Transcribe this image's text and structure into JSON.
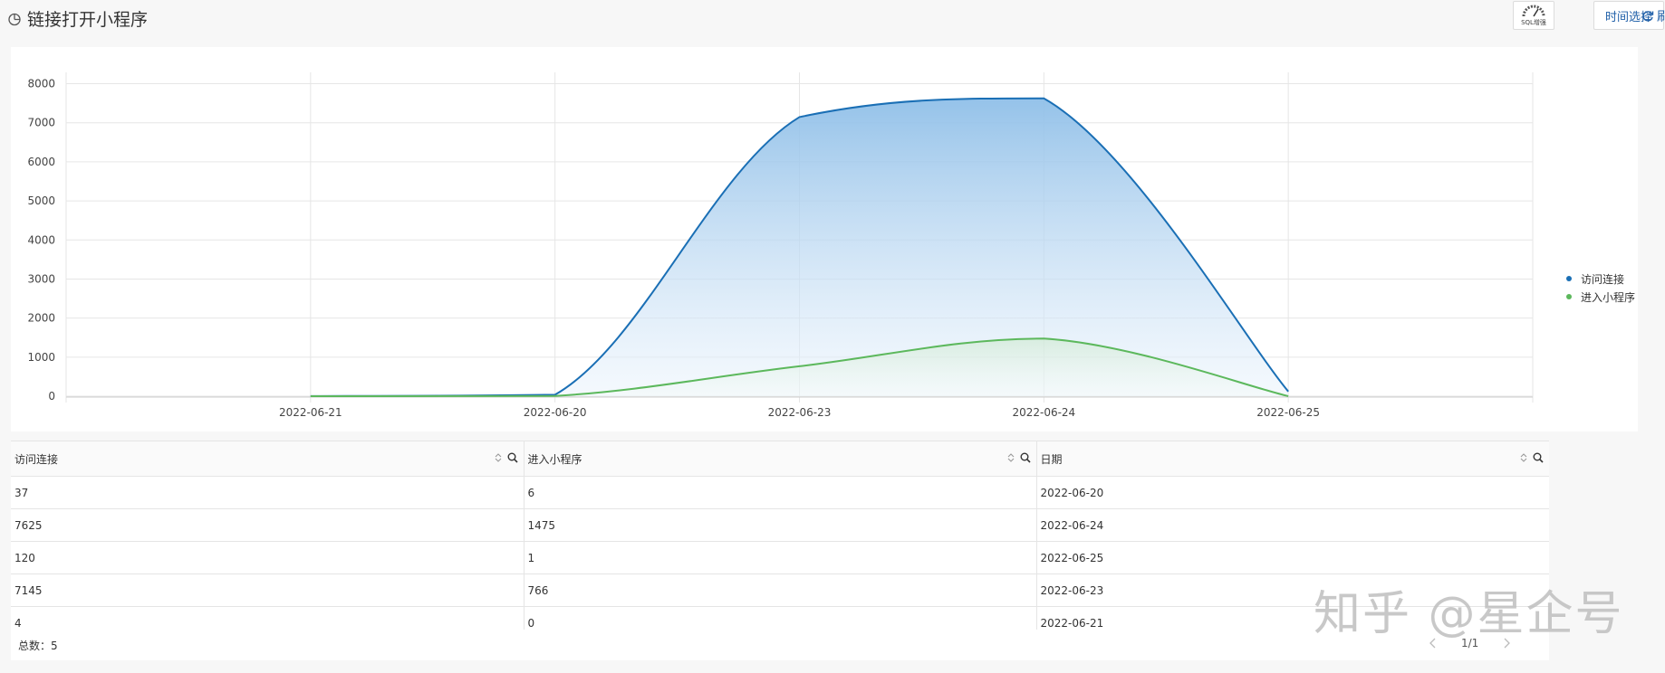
{
  "header": {
    "title": "链接打开小程序",
    "sql_label": "SQL增强",
    "time_button": "时间选择",
    "refresh_label": "刷"
  },
  "chart_data": {
    "type": "area",
    "x": [
      "2022-06-21",
      "2022-06-20",
      "2022-06-23",
      "2022-06-24",
      "2022-06-25"
    ],
    "series": [
      {
        "name": "访问连接",
        "values": [
          4,
          37,
          7145,
          7625,
          120
        ],
        "color": "#1a6fb5"
      },
      {
        "name": "进入小程序",
        "values": [
          0,
          6,
          766,
          1475,
          1
        ],
        "color": "#5cb85c"
      }
    ],
    "ylim": [
      0,
      8000
    ],
    "yticks": [
      0,
      1000,
      2000,
      3000,
      4000,
      5000,
      6000,
      7000,
      8000
    ],
    "grid": true,
    "legend_position": "right"
  },
  "table": {
    "columns": [
      "访问连接",
      "进入小程序",
      "日期"
    ],
    "rows": [
      [
        "37",
        "6",
        "2022-06-20"
      ],
      [
        "7625",
        "1475",
        "2022-06-24"
      ],
      [
        "120",
        "1",
        "2022-06-25"
      ],
      [
        "7145",
        "766",
        "2022-06-23"
      ],
      [
        "4",
        "0",
        "2022-06-21"
      ]
    ]
  },
  "footer": {
    "total": "总数：5",
    "page": "1/1"
  },
  "watermark": "知乎 @星企号"
}
